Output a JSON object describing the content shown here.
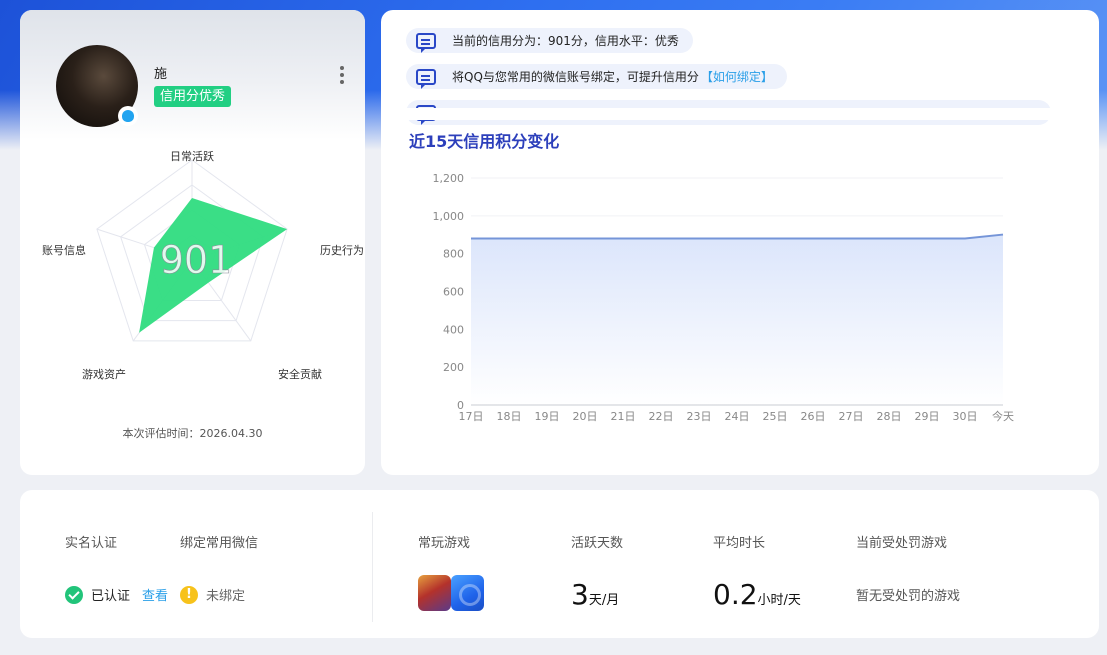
{
  "profile": {
    "nickname": "施",
    "credit_tag": "信用分优秀",
    "score": "901",
    "eval_time": "本次评估时间：2026.04.30",
    "radar_labels": [
      "日常活跃",
      "历史行为",
      "安全贡献",
      "游戏资产",
      "账号信息"
    ],
    "radar_values": [
      0.62,
      1.0,
      0.28,
      0.9,
      0.4
    ],
    "radar_fill": "#2fdc7f"
  },
  "notices": [
    {
      "text": "当前的信用分为：901分，信用水平：优秀",
      "link": ""
    },
    {
      "text": "将QQ与您常用的微信账号绑定，可提升信用分",
      "link": "【如何绑定】"
    }
  ],
  "chart_title": "近15天信用积分变化",
  "chart_data": {
    "type": "area",
    "x": [
      "17日",
      "18日",
      "19日",
      "20日",
      "21日",
      "22日",
      "23日",
      "24日",
      "25日",
      "26日",
      "27日",
      "28日",
      "29日",
      "30日",
      "今天"
    ],
    "series": [
      {
        "values": [
          880,
          880,
          880,
          880,
          880,
          880,
          880,
          880,
          880,
          880,
          880,
          880,
          880,
          880,
          901
        ]
      }
    ],
    "yticks": [
      "0",
      "200",
      "400",
      "600",
      "800",
      "1,000",
      "1,200"
    ],
    "ylim": [
      0,
      1200
    ],
    "line_color": "#7595d8",
    "fill_color": "#dbe5fb"
  },
  "stats": {
    "real_name_label": "实名认证",
    "real_name_value": "已认证",
    "real_name_link": "查看",
    "wechat_label": "绑定常用微信",
    "wechat_value": "未绑定",
    "warn_symbol": "!",
    "games_label": "常玩游戏",
    "active_days_label": "活跃天数",
    "active_days_value": "3",
    "active_days_unit": "天/月",
    "avg_duration_label": "平均时长",
    "avg_duration_value": "0.2",
    "avg_duration_unit": "小时/天",
    "punish_label": "当前受处罚游戏",
    "punish_value": "暂无受处罚的游戏"
  }
}
